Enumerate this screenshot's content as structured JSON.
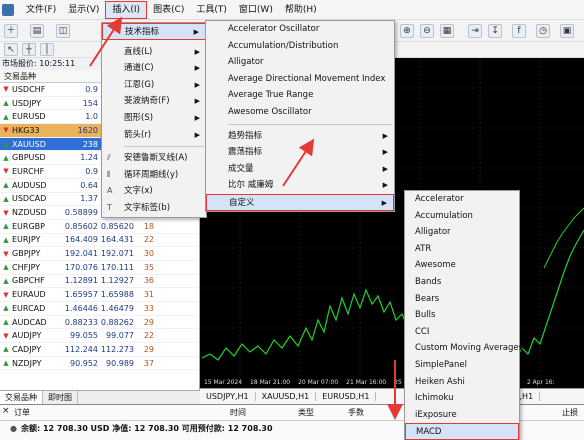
{
  "menubar": {
    "items": [
      "文件(F)",
      "显示(V)",
      "插入(I)",
      "图表(C)",
      "工具(T)",
      "窗口(W)",
      "帮助(H)"
    ]
  },
  "market_watch": {
    "title": "市场报价: 10:25:11",
    "header": "交易品种",
    "rows": [
      {
        "sym": "USDCHF",
        "bid": "0.9",
        "ask": "",
        "spr": ""
      },
      {
        "sym": "USDJPY",
        "bid": "154",
        "ask": "",
        "spr": ""
      },
      {
        "sym": "EURUSD",
        "bid": "1.0",
        "ask": "",
        "spr": ""
      },
      {
        "sym": "HKG33",
        "bid": "1620",
        "ask": "",
        "spr": ""
      },
      {
        "sym": "XAUUSD",
        "bid": "238",
        "ask": "",
        "spr": ""
      },
      {
        "sym": "GBPUSD",
        "bid": "1.24",
        "ask": "",
        "spr": ""
      },
      {
        "sym": "EURCHF",
        "bid": "0.9",
        "ask": "",
        "spr": ""
      },
      {
        "sym": "AUDUSD",
        "bid": "0.64",
        "ask": "",
        "spr": ""
      },
      {
        "sym": "USDCAD",
        "bid": "1.37",
        "ask": "",
        "spr": ""
      },
      {
        "sym": "NZDUSD",
        "bid": "0.58899",
        "ask": "0.58916",
        "spr": "17"
      },
      {
        "sym": "EURGBP",
        "bid": "0.85602",
        "ask": "0.85620",
        "spr": "18"
      },
      {
        "sym": "EURJPY",
        "bid": "164.409",
        "ask": "164.431",
        "spr": "22"
      },
      {
        "sym": "GBPJPY",
        "bid": "192.041",
        "ask": "192.071",
        "spr": "30"
      },
      {
        "sym": "CHFJPY",
        "bid": "170.076",
        "ask": "170.111",
        "spr": "35"
      },
      {
        "sym": "GBPCHF",
        "bid": "1.12891",
        "ask": "1.12927",
        "spr": "36"
      },
      {
        "sym": "EURAUD",
        "bid": "1.65957",
        "ask": "1.65988",
        "spr": "31"
      },
      {
        "sym": "EURCAD",
        "bid": "1.46446",
        "ask": "1.46479",
        "spr": "33"
      },
      {
        "sym": "AUDCAD",
        "bid": "0.88233",
        "ask": "0.88262",
        "spr": "29"
      },
      {
        "sym": "AUDJPY",
        "bid": "99.055",
        "ask": "99.077",
        "spr": "22"
      },
      {
        "sym": "CADJPY",
        "bid": "112.244",
        "ask": "112.273",
        "spr": "29"
      },
      {
        "sym": "NZDJPY",
        "bid": "90.952",
        "ask": "90.989",
        "spr": "37"
      }
    ],
    "tabs": [
      "交易品种",
      "即时图"
    ]
  },
  "insert_menu": {
    "items": [
      "技术指标",
      "直线(L)",
      "通道(C)",
      "江恩(G)",
      "斐波纳奇(F)",
      "图形(S)",
      "箭头(r)",
      "安德鲁斯叉线(A)",
      "循环周期线(y)",
      "文字(x)",
      "文字标签(b)"
    ]
  },
  "indicator_menu": {
    "items": [
      "Accelerator Oscillator",
      "Accumulation/Distribution",
      "Alligator",
      "Average Directional Movement Index",
      "Average True Range",
      "Awesome Oscillator",
      "趋势指标",
      "震荡指标",
      "成交量",
      "比尔 威廉姆",
      "自定义"
    ]
  },
  "custom_menu": {
    "items": [
      "Accelerator",
      "Accumulation",
      "Alligator",
      "ATR",
      "Awesome",
      "Bands",
      "Bears",
      "Bulls",
      "CCI",
      "Custom Moving Averages",
      "SimplePanel",
      "Heiken Ashi",
      "Ichimoku",
      "iExposure",
      "MACD"
    ]
  },
  "chart": {
    "time_ticks": [
      "15 Mar 2024",
      "18 Mar 21:00",
      "20 Mar 07:00",
      "21 Mar 16:00",
      "25 M",
      "2 Apr 16:"
    ]
  },
  "chart_tabs": [
    "USDJPY,H1",
    "XAUUSD,H1",
    "EURUSD,H1",
    "USD,H1"
  ],
  "terminal": {
    "col_order": "订单",
    "col_time": "时间",
    "col_type": "类型",
    "col_lots": "手数",
    "col_sl": "止损",
    "balance": "余额: 12 708.30 USD  净值: 12 708.30  可用预付款: 12 708.30"
  }
}
